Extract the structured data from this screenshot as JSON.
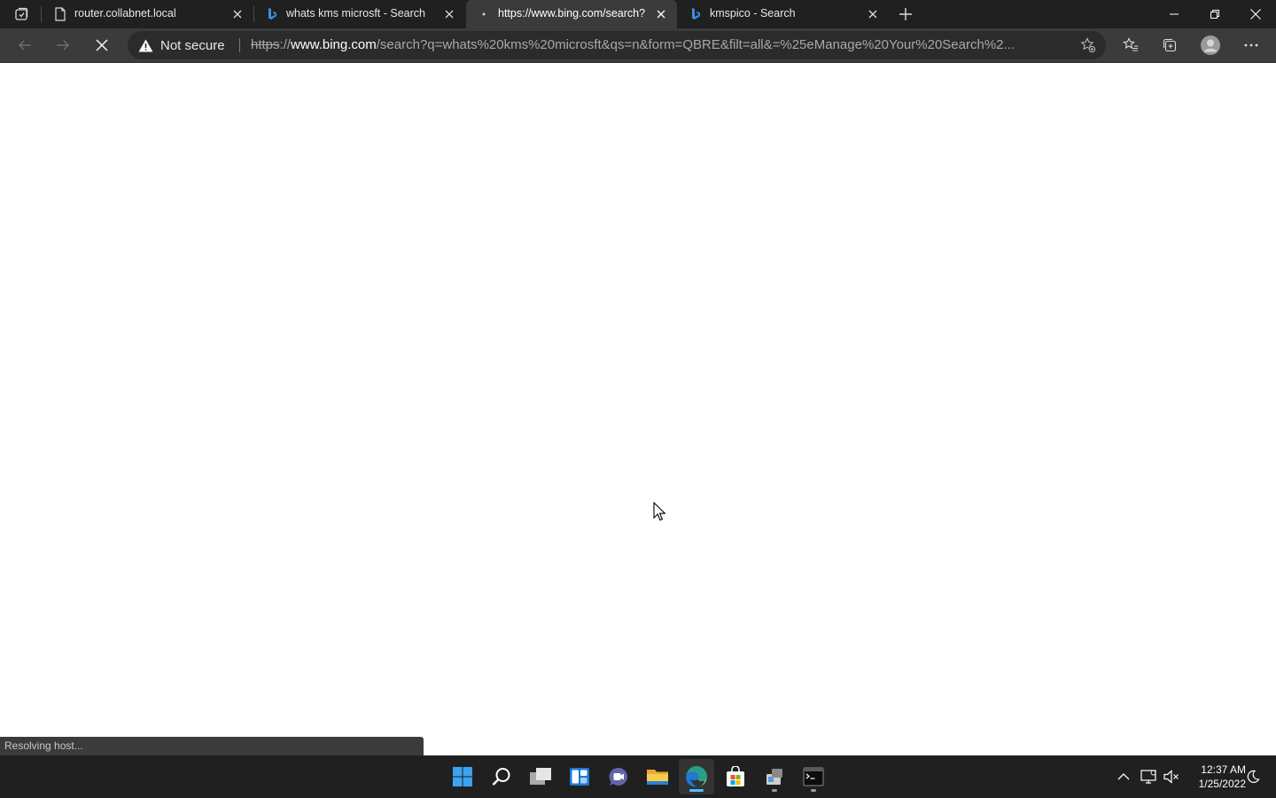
{
  "browser": {
    "tabs": [
      {
        "title": "router.collabnet.local",
        "favicon": "page-icon"
      },
      {
        "title": "whats kms microsft - Search",
        "favicon": "bing-icon"
      },
      {
        "title": "https://www.bing.com/search?q=",
        "favicon": "loading-icon",
        "active": true
      },
      {
        "title": "kmspico - Search",
        "favicon": "bing-icon"
      }
    ],
    "security_label": "Not secure",
    "url": {
      "scheme": "https",
      "separator": "://",
      "host": "www.bing.com",
      "path": "/search?q=whats%20kms%20microsft&qs=n&form=QBRE&filt=all&=%25eManage%20Your%20Search%2..."
    },
    "status_text": "Resolving host..."
  },
  "taskbar": {
    "apps": [
      "start-icon",
      "search-icon",
      "task-view-icon",
      "widgets-icon",
      "chat-icon",
      "file-explorer-icon",
      "edge-icon",
      "store-icon",
      "app-icon",
      "terminal-icon"
    ],
    "time": "12:37 AM",
    "date": "1/25/2022"
  },
  "colors": {
    "tabstrip": "#202020",
    "toolbar": "#3b3b3b",
    "taskbar": "#202020",
    "accent": "#4cc2ff"
  }
}
